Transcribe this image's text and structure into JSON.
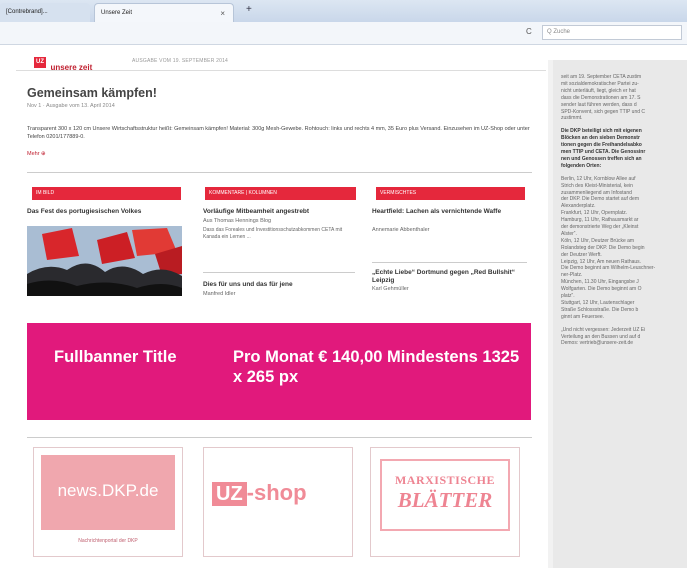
{
  "browser": {
    "tab1_label": "[Contrebrand]...",
    "tab2_label": "Unsere Zeit",
    "tab_close": "×",
    "new_tab": "+",
    "reload": "C",
    "search_placeholder": "Q Zuche"
  },
  "header": {
    "logo_box": "UZ",
    "logo_text": "unsere zeit",
    "edition": "AUSGABE VOM 19. SEPTEMBER 2014"
  },
  "article": {
    "title": "Gemeinsam kämpfen!",
    "meta": "Nov 1 · Ausgabe vom 13. April 2014",
    "body": "Transparent 300 x 120 cm Unsere Wirtschaftsstruktur heißt: Gemeinsam kämpfen! Material: 300g Mesh-Gewebe. Rohtouch: links und rechts 4 mm, 35 Euro plus Versand. Einzusehen im UZ-Shop oder unter Telefon 0201/177889-0.",
    "more": "Mehr ⊕"
  },
  "columns": [
    {
      "head": "IM BILD",
      "title": "Das Fest des portugiesischen Volkes",
      "sub": ""
    },
    {
      "head": "KOMMENTARE | KOLUMNEN",
      "title": "Vorläufige Mitbeamheit angestrebt",
      "sub": "Aus Thomas Hennings Blog",
      "note": "Dass das Foreales und Investitionsschutzabkommen CETA mit Kanada ein Lernen ...",
      "title2": "Dies für uns und das für jene",
      "sub2": "Manfred Idler"
    },
    {
      "head": "VERMISCHTES",
      "title": "Heartfield: Lachen als vernichtende Waffe",
      "sub": "Annemarie Abbenthaler",
      "title2": "„Echte Liebe“ Dortmund gegen „Red Bullshit“ Leipzig",
      "sub2": "Karl Gehmüller"
    }
  ],
  "banner": {
    "line1": "Fullbanner Title",
    "line2": "Pro Monat € 140,00 Mindestens 1325 x 265 px"
  },
  "ads": {
    "dkp_logo": "news.DKP.de",
    "dkp_caption": "Nachrichtenportal der DKP",
    "uz_box": "UZ",
    "uz_shop": "-shop",
    "mb_line1": "MARXISTISCHE",
    "mb_line2": "BLÄTTER"
  },
  "sidebar": {
    "lines": [
      {
        "t": "seit am 19. September CETA zustim",
        "b": false
      },
      {
        "t": "mit sozialdemokratischer Partei zu-",
        "b": false
      },
      {
        "t": "nicht unterläuft, liegt, gleich er hat",
        "b": false
      },
      {
        "t": "dass die Demonstrationen am 17. S",
        "b": false
      },
      {
        "t": "sender laut führen werden, dass d",
        "b": false
      },
      {
        "t": "SPD-Konvent, sich gegen TTIP und C",
        "b": false
      },
      {
        "t": "zustimmt.",
        "b": false
      },
      {
        "t": "",
        "b": false
      },
      {
        "t": "Die DKP beteiligt sich mit eigenen",
        "b": true
      },
      {
        "t": "Blöcken an den sieben Demonstr",
        "b": true
      },
      {
        "t": "tionen gegen die Freihandelsabko",
        "b": true
      },
      {
        "t": "men TTIP und CETA. Die Genossinr",
        "b": true
      },
      {
        "t": "nen und Genossen treffen sich an",
        "b": true
      },
      {
        "t": "folgenden Orten:",
        "b": true
      },
      {
        "t": "",
        "b": false
      },
      {
        "t": "Berlin, 12 Uhr, Kornblow Allee auf",
        "b": false
      },
      {
        "t": "Strich des Kleist-Ministerial, kein",
        "b": false
      },
      {
        "t": "zusammenliegend am Infostand",
        "b": false
      },
      {
        "t": "der DKP. Die Demo startet auf dem",
        "b": false
      },
      {
        "t": "Alexanderplatz.",
        "b": false
      },
      {
        "t": "Frankfurt, 12 Uhr, Opernplatz.",
        "b": false
      },
      {
        "t": "Hamburg, 11 Uhr, Rathausmarkt ar",
        "b": false
      },
      {
        "t": "der demonstrierte Weg der „Kleinst",
        "b": false
      },
      {
        "t": "Alster“.",
        "b": false
      },
      {
        "t": "Köln, 12 Uhr, Deutzer Brücke am",
        "b": false
      },
      {
        "t": "Rolandsteg der DKP. Die Demo begin",
        "b": false
      },
      {
        "t": "der Deutzer Werft.",
        "b": false
      },
      {
        "t": "Leipzig, 12 Uhr, Am neuen Rathaus.",
        "b": false
      },
      {
        "t": "Die Demo beginnt am Wilhelm-Leuschner-",
        "b": false
      },
      {
        "t": "ner-Platz.",
        "b": false
      },
      {
        "t": "München, 11.30 Uhr, Eingangsbe J",
        "b": false
      },
      {
        "t": "Wolfgarten. Die Demo beginnt am O",
        "b": false
      },
      {
        "t": "platz“.",
        "b": false
      },
      {
        "t": "Stuttgart, 12 Uhr, Lautenschlager",
        "b": false
      },
      {
        "t": "Straße Schlossstraße. Die Demo b",
        "b": false
      },
      {
        "t": "ginnt am Feuersee.",
        "b": false
      },
      {
        "t": "",
        "b": false
      },
      {
        "t": "„Und nicht vergessen: Jederzeit UZ Ei",
        "b": false
      },
      {
        "t": "Verteilung an den Bussen und auf d",
        "b": false
      },
      {
        "t": "Demos: vertrieb@unsere-zeit.de",
        "b": false
      }
    ]
  }
}
